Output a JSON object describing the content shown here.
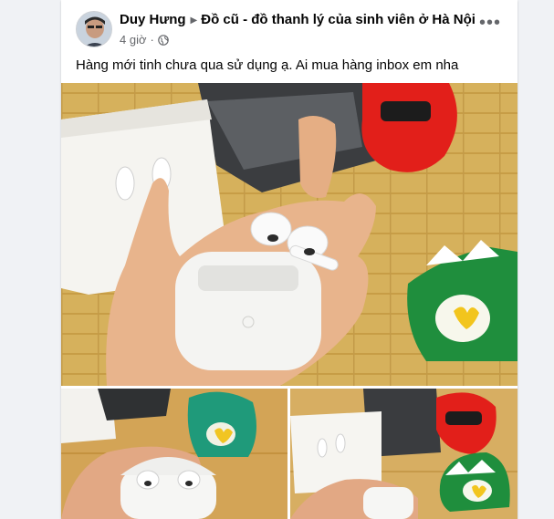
{
  "post": {
    "author": "Duy Hưng",
    "group": "Đồ cũ - đồ thanh lý của sinh viên ở Hà Nội",
    "time": "4 giờ",
    "separator": "·",
    "more_label": "•••",
    "text": "Hàng mới tinh chưa qua sử dụng ạ. Ai mua hàng inbox em nha"
  },
  "icons": {
    "caret": "caret-right-icon",
    "audience": "globe-icon",
    "more": "more-options-icon"
  },
  "colors": {
    "text_primary": "#050505",
    "text_secondary": "#65676b",
    "page_bg": "#f0f2f5",
    "card_bg": "#ffffff"
  }
}
